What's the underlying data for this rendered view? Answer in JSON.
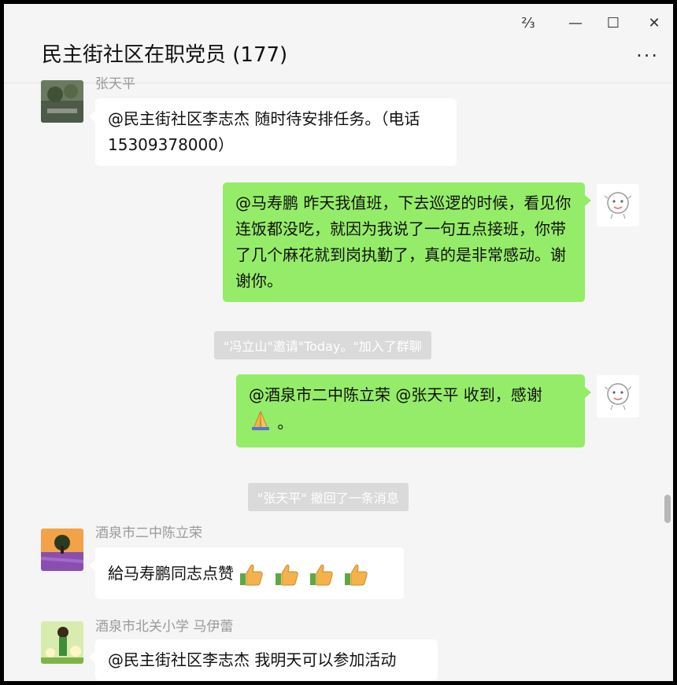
{
  "window": {
    "title": "民主街社区在职党员 (177)",
    "controls": {
      "pin": "⅔",
      "minimize": "—",
      "maximize": "☐",
      "close": "✕"
    },
    "more_label": "···"
  },
  "messages": {
    "m1": {
      "sender": "张天平",
      "text": "@民主街社区李志杰 随时待安排任务。（电话15309378000）"
    },
    "m2": {
      "text": "@马寿鹏 昨天我值班，下去巡逻的时候，看见你连饭都没吃，就因为我说了一句五点接班，你带了几个麻花就到岗执勤了，真的是非常感动。谢谢你。"
    },
    "sys1": {
      "text": "\"冯立山\"邀请\"Today。\"加入了群聊"
    },
    "m3": {
      "text": "@酒泉市二中陈立荣 @张天平 收到，感谢",
      "text2": "。"
    },
    "sys2": {
      "text": "\"张天平\" 撤回了一条消息"
    },
    "m4": {
      "sender": "酒泉市二中陈立荣",
      "text": "給马寿鹏同志点赞"
    },
    "m5": {
      "sender": "酒泉市北关小学 马伊蕾",
      "text": "@民主街社区李志杰 我明天可以参加活动"
    }
  },
  "colors": {
    "out_bubble": "#95ec69",
    "in_bubble": "#ffffff",
    "background": "#f5f5f5"
  },
  "icons": [
    "pin-icon",
    "minimize-icon",
    "maximize-icon",
    "close-icon",
    "more-icon",
    "thumbs-up-icon",
    "pray-icon"
  ]
}
